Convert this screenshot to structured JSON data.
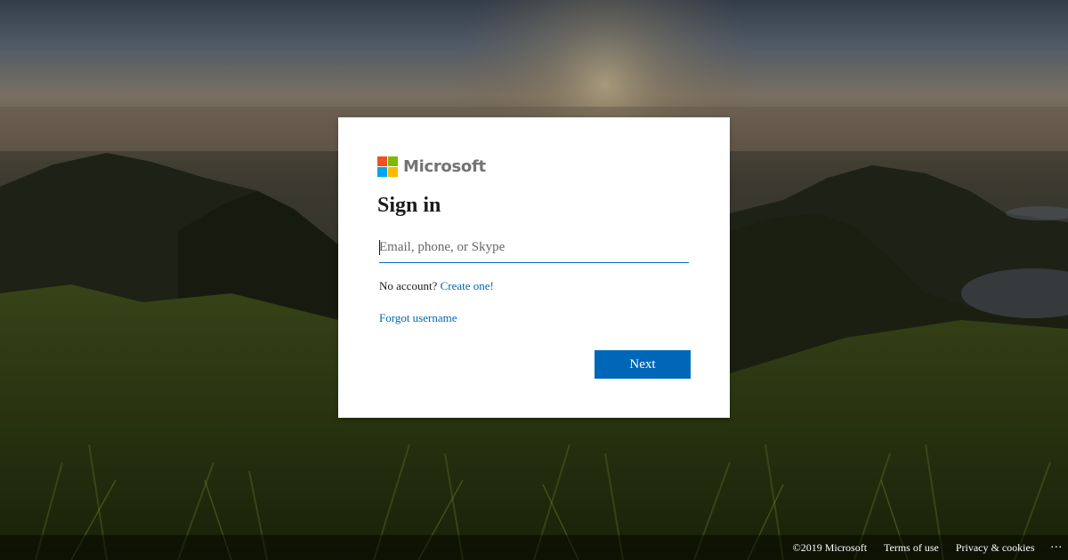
{
  "brand": {
    "name": "Microsoft",
    "logo_colors": [
      "#f25022",
      "#7fba00",
      "#00a4ef",
      "#ffb900"
    ]
  },
  "signin": {
    "title": "Sign in",
    "email_placeholder": "Email, phone, or Skype",
    "email_value": "",
    "no_account_text": "No account?",
    "create_link": "Create one!",
    "forgot_link": "Forgot username",
    "next_label": "Next"
  },
  "footer": {
    "copyright": "©2019 Microsoft",
    "terms": "Terms of use",
    "privacy": "Privacy & cookies",
    "more": "..."
  },
  "colors": {
    "accent": "#0067b8",
    "card_bg": "#ffffff"
  }
}
